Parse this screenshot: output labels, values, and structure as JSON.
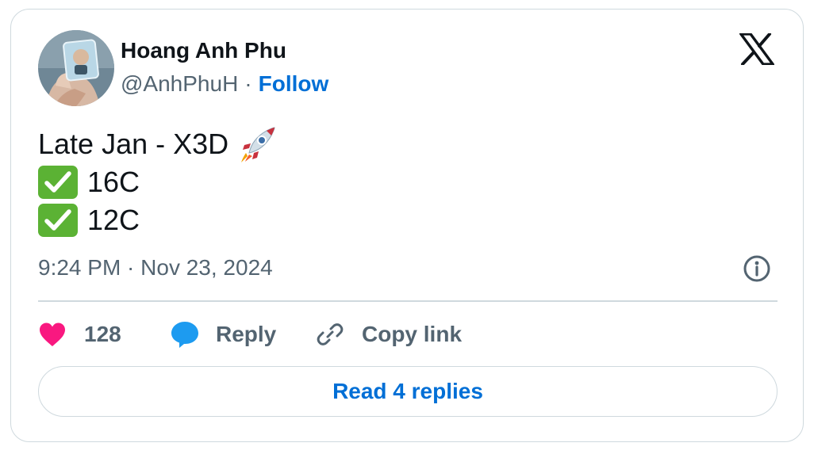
{
  "author": {
    "name": "Hoang Anh Phu",
    "handle": "@AnhPhuH",
    "separator": "·",
    "follow_label": "Follow"
  },
  "platform_icon": "x-logo-icon",
  "tweet": {
    "lines": [
      {
        "text": "Late Jan - X3D",
        "emoji": "rocket-icon"
      },
      {
        "prefix_icon": "check-mark-button-icon",
        "text": "16C"
      },
      {
        "prefix_icon": "check-mark-button-icon",
        "text": "12C"
      }
    ],
    "timestamp": "9:24 PM · Nov 23, 2024"
  },
  "actions": {
    "like_count": "128",
    "reply_label": "Reply",
    "copy_link_label": "Copy link"
  },
  "read_replies_label": "Read 4 replies",
  "colors": {
    "primary_text": "#0f1419",
    "secondary_text": "#536471",
    "link_blue": "#006fd6",
    "like_pink": "#f91880",
    "reply_blue": "#1d9bf0",
    "check_green": "#5bb234",
    "border": "#cfd9de"
  }
}
